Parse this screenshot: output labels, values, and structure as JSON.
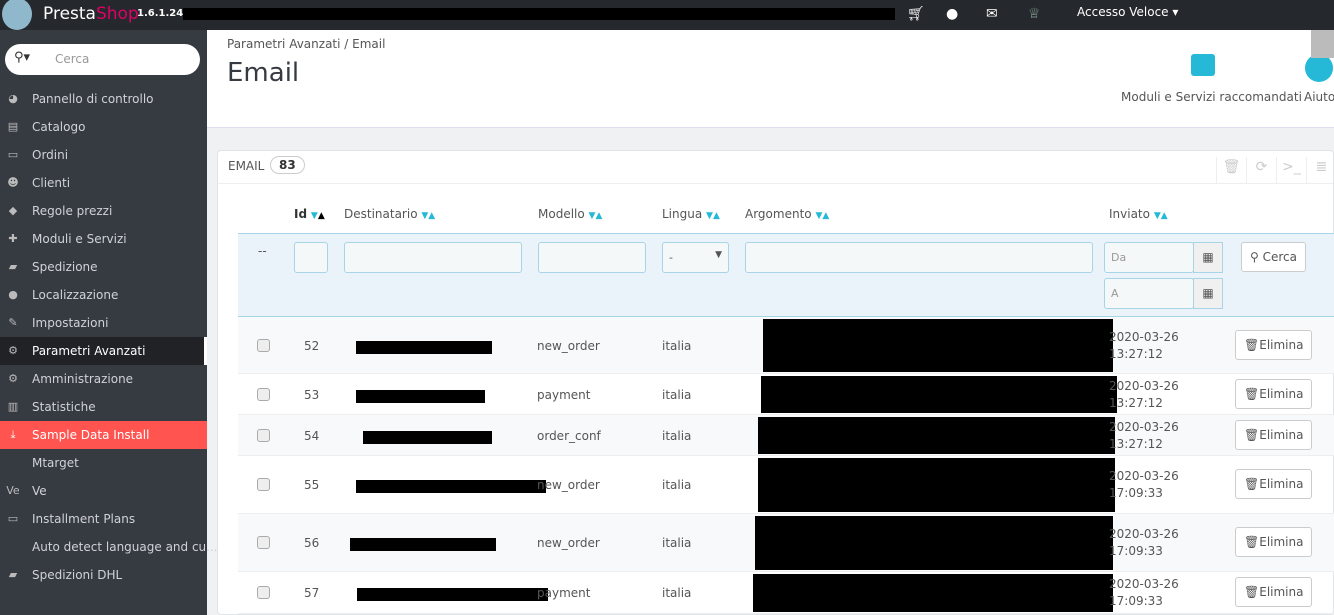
{
  "topbar": {
    "brand_a": "Presta",
    "brand_b": "Shop",
    "version": "1.6.1.24",
    "quick_access": "Accesso Veloce ▾",
    "icons": [
      "cart-icon",
      "user-icon",
      "envelope-icon",
      "trophy-icon"
    ]
  },
  "sidebar": {
    "search_placeholder": "Cerca",
    "items": [
      {
        "label": "Pannello di controllo",
        "icon": "dashboard-icon",
        "glyph": "◕"
      },
      {
        "label": "Catalogo",
        "icon": "book-icon",
        "glyph": "▤"
      },
      {
        "label": "Ordini",
        "icon": "credit-card-icon",
        "glyph": "▭"
      },
      {
        "label": "Clienti",
        "icon": "users-icon",
        "glyph": "☻"
      },
      {
        "label": "Regole prezzi",
        "icon": "tags-icon",
        "glyph": "◆"
      },
      {
        "label": "Moduli e Servizi",
        "icon": "puzzle-icon",
        "glyph": "✚"
      },
      {
        "label": "Spedizione",
        "icon": "truck-icon",
        "glyph": "▰"
      },
      {
        "label": "Localizzazione",
        "icon": "globe-icon",
        "glyph": "●"
      },
      {
        "label": "Impostazioni",
        "icon": "wrench-icon",
        "glyph": "✎"
      },
      {
        "label": "Parametri Avanzati",
        "icon": "cogs-icon",
        "glyph": "⚙"
      },
      {
        "label": "Amministrazione",
        "icon": "cog-icon",
        "glyph": "⚙"
      },
      {
        "label": "Statistiche",
        "icon": "bar-chart-icon",
        "glyph": "▥"
      },
      {
        "label": "Sample Data Install",
        "icon": "download-icon",
        "glyph": "⤓"
      },
      {
        "label": "Mtarget",
        "icon": "",
        "glyph": ""
      },
      {
        "label": "Ve",
        "icon": "ve-icon",
        "glyph": "Ve"
      },
      {
        "label": "Installment Plans",
        "icon": "credit-card-icon",
        "glyph": "▭"
      },
      {
        "label": "Auto detect language and cu...",
        "icon": "",
        "glyph": ""
      },
      {
        "label": "Spedizioni DHL",
        "icon": "truck-icon",
        "glyph": "▰"
      }
    ]
  },
  "header": {
    "breadcrumb": "Parametri Avanzati  /  Email",
    "title": "Email",
    "modules_label": "Moduli e Servizi raccomandati",
    "help_label": "Aiuto"
  },
  "panel": {
    "title": "EMAIL",
    "count": "83",
    "columns": {
      "id": "Id",
      "dest": "Destinatario",
      "model": "Modello",
      "lang": "Lingua",
      "subject": "Argomento",
      "sent": "Inviato"
    },
    "filter": {
      "dash": "--",
      "lang_value": "-",
      "from_placeholder": "Da",
      "to_placeholder": "A",
      "search": "Cerca"
    },
    "delete_label": "Elimina",
    "rows": [
      {
        "id": "52",
        "model": "new_order",
        "lang": "italia",
        "date": "2020-03-26",
        "time": "13:27:12"
      },
      {
        "id": "53",
        "model": "payment",
        "lang": "italia",
        "date": "2020-03-26",
        "time": "13:27:12"
      },
      {
        "id": "54",
        "model": "order_conf",
        "lang": "italia",
        "date": "2020-03-26",
        "time": "13:27:12"
      },
      {
        "id": "55",
        "model": "new_order",
        "lang": "italia",
        "date": "2020-03-26",
        "time": "17:09:33"
      },
      {
        "id": "56",
        "model": "new_order",
        "lang": "italia",
        "date": "2020-03-26",
        "time": "17:09:33"
      },
      {
        "id": "57",
        "model": "payment",
        "lang": "italia",
        "date": "2020-03-26",
        "time": "17:09:33"
      }
    ]
  },
  "colors": {
    "accent": "#25b9d7",
    "active_red": "#ff5450",
    "sidebar": "#363a41",
    "topbar": "#25282c"
  }
}
